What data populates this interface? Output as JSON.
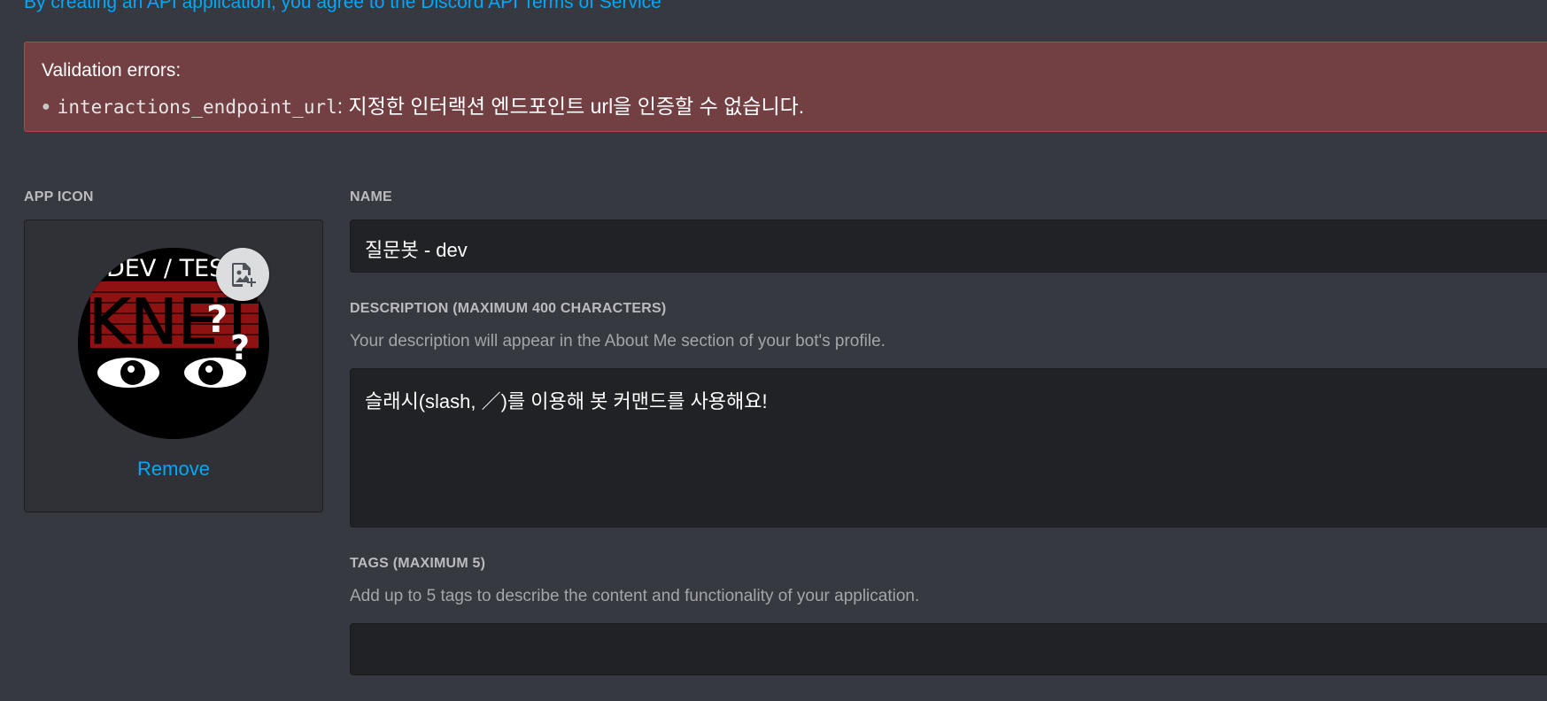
{
  "header": {
    "terms_text": "By creating an API application, you agree to the Discord API Terms of Service"
  },
  "errors": {
    "title": "Validation errors:",
    "items": [
      {
        "field": "interactions_endpoint_url",
        "separator": ":",
        "message": " 지정한 인터랙션 엔드포인트 url을 인증할 수 없습니다."
      }
    ]
  },
  "app_icon": {
    "label": "APP ICON",
    "avatar_text_top": "DEV / TEST",
    "avatar_text_logo": "KNET",
    "remove_label": "Remove"
  },
  "name_field": {
    "label": "NAME",
    "value": "질문봇 - dev"
  },
  "description_field": {
    "label": "DESCRIPTION (MAXIMUM 400 CHARACTERS)",
    "helper": "Your description will appear in the About Me section of your bot's profile.",
    "value": "슬래시(slash, ／)를 이용해 봇 커맨드를 사용해요!"
  },
  "tags_field": {
    "label": "TAGS (MAXIMUM 5)",
    "helper": "Add up to 5 tags to describe the content and functionality of your application.",
    "value": ""
  },
  "colors": {
    "background": "#36393f",
    "link": "#00a8fc",
    "error_bg": "#723f43",
    "error_border": "#c04046",
    "input_bg": "#202225"
  },
  "icons": {
    "upload": "add-image-icon",
    "bullet": "bullet-dot"
  }
}
